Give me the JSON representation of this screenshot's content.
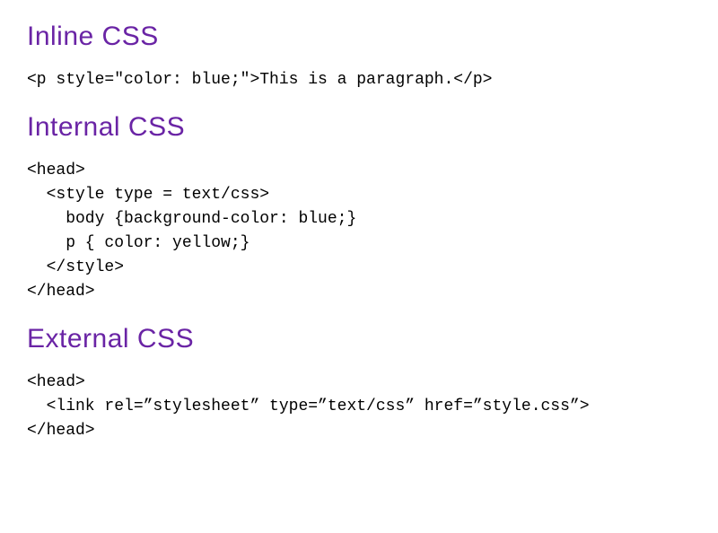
{
  "sections": [
    {
      "heading": "Inline CSS",
      "code": "<p style=\"color: blue;\">This is a paragraph.</p>"
    },
    {
      "heading": "Internal CSS",
      "code": "<head>\n  <style type = text/css>\n    body {background-color: blue;}\n    p { color: yellow;}\n  </style>\n</head>"
    },
    {
      "heading": "External CSS",
      "code": "<head>\n  <link rel=”stylesheet” type=”text/css” href=”style.css”>\n</head>"
    }
  ]
}
